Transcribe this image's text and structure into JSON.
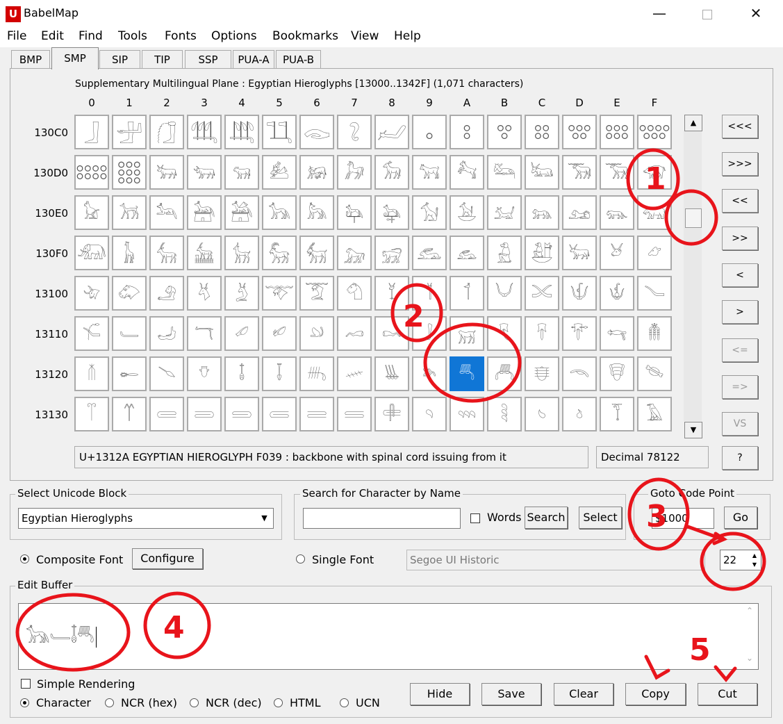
{
  "window": {
    "title": "BabelMap",
    "icon_letter": "U"
  },
  "menu": [
    "File",
    "Edit",
    "Find",
    "Tools",
    "Fonts",
    "Options",
    "Bookmarks",
    "View",
    "Help"
  ],
  "tabs": [
    "BMP",
    "SMP",
    "SIP",
    "TIP",
    "SSP",
    "PUA-A",
    "PUA-B"
  ],
  "active_tab": "SMP",
  "grid": {
    "caption": "Supplementary Multilingual Plane : Egyptian Hieroglyphs [13000..1342F] (1,071 characters)",
    "columns": [
      "0",
      "1",
      "2",
      "3",
      "4",
      "5",
      "6",
      "7",
      "8",
      "9",
      "A",
      "B",
      "C",
      "D",
      "E",
      "F"
    ],
    "rows": [
      {
        "label": "130C0",
        "chars": [
          "𓃀",
          "𓃁",
          "𓃂",
          "𓃃",
          "𓃄",
          "𓃅",
          "𓃆",
          "𓃇",
          "𓃈",
          "𓃉",
          "𓃊",
          "𓃋",
          "𓃌",
          "𓃍",
          "𓃎",
          "𓃏"
        ]
      },
      {
        "label": "130D0",
        "chars": [
          "𓃐",
          "𓃑",
          "𓃒",
          "𓃓",
          "𓃔",
          "𓃕",
          "𓃖",
          "𓃗",
          "𓃘",
          "𓃙",
          "𓃚",
          "𓃛",
          "𓃜",
          "𓃝",
          "𓃞",
          "𓃟"
        ]
      },
      {
        "label": "130E0",
        "chars": [
          "𓃠",
          "𓃡",
          "𓃢",
          "𓃣",
          "𓃤",
          "𓃥",
          "𓃦",
          "𓃧",
          "𓃨",
          "𓃩",
          "𓃪",
          "𓃫",
          "𓃬",
          "𓃭",
          "𓃮",
          "𓃯"
        ]
      },
      {
        "label": "130F0",
        "chars": [
          "𓃰",
          "𓃱",
          "𓃲",
          "𓃳",
          "𓃴",
          "𓃵",
          "𓃶",
          "𓃷",
          "𓃸",
          "𓃹",
          "𓃺",
          "𓃻",
          "𓃼",
          "𓃽",
          "𓃾",
          "𓃿"
        ]
      },
      {
        "label": "13100",
        "chars": [
          "𓄀",
          "𓄁",
          "𓄂",
          "𓄃",
          "𓄄",
          "𓄅",
          "𓄆",
          "𓄇",
          "𓄈",
          "𓄉",
          "𓄊",
          "𓄋",
          "𓄌",
          "𓄍",
          "𓄎",
          "𓄏"
        ]
      },
      {
        "label": "13110",
        "chars": [
          "𓄐",
          "𓄑",
          "𓄒",
          "𓄓",
          "𓄔",
          "𓄕",
          "𓄖",
          "𓄗",
          "𓄘",
          "𓄙",
          "𓄚",
          "𓄛",
          "𓄜",
          "𓄝",
          "𓄞",
          "𓄟"
        ]
      },
      {
        "label": "13120",
        "chars": [
          "𓄠",
          "𓄡",
          "𓄢",
          "𓄣",
          "𓄤",
          "𓄥",
          "𓄦",
          "𓄧",
          "𓄨",
          "𓄩",
          "𓄪",
          "𓄫",
          "𓄬",
          "𓄭",
          "𓄮",
          "𓄯"
        ]
      },
      {
        "label": "13130",
        "chars": [
          "𓄰",
          "𓄱",
          "𓄲",
          "𓄳",
          "𓄴",
          "𓄵",
          "𓄶",
          "𓄷",
          "𓄸",
          "𓄹",
          "𓄺",
          "𓄻",
          "𓄼",
          "𓄽",
          "𓄾",
          "𓄿"
        ]
      }
    ],
    "selected": {
      "row": 6,
      "col": 10
    },
    "status_name": "U+1312A EGYPTIAN HIEROGLYPH F039 : backbone with spinal cord issuing from it",
    "status_decimal": "Decimal 78122"
  },
  "nav_buttons": [
    "<<<",
    ">>>",
    "<<",
    ">>",
    "<",
    ">",
    "<=",
    "=>",
    "VS",
    "?"
  ],
  "block_select": {
    "label": "Select Unicode Block",
    "value": "Egyptian Hieroglyphs"
  },
  "search": {
    "label": "Search for Character by Name",
    "value": "",
    "words_label": "Words",
    "search_button": "Search",
    "select_button": "Select"
  },
  "goto": {
    "label": "Goto Code Point",
    "value": "$1000",
    "go_button": "Go"
  },
  "font": {
    "composite_label": "Composite Font",
    "configure_button": "Configure",
    "single_label": "Single Font",
    "single_font_value": "Segoe UI Historic",
    "size": "22"
  },
  "edit_buffer": {
    "label": "Edit Buffer",
    "content": "𓃥𓄑𓄤𓄪"
  },
  "options": {
    "simple_rendering": "Simple Rendering",
    "formats": [
      "Character",
      "NCR (hex)",
      "NCR (dec)",
      "HTML",
      "UCN"
    ]
  },
  "buttons": {
    "hide": "Hide",
    "save": "Save",
    "clear": "Clear",
    "copy": "Copy",
    "cut": "Cut"
  },
  "annotations": [
    "1",
    "2",
    "3",
    "4",
    "5"
  ],
  "colors": {
    "selection": "#1076d6",
    "annotation": "#e8141b"
  }
}
